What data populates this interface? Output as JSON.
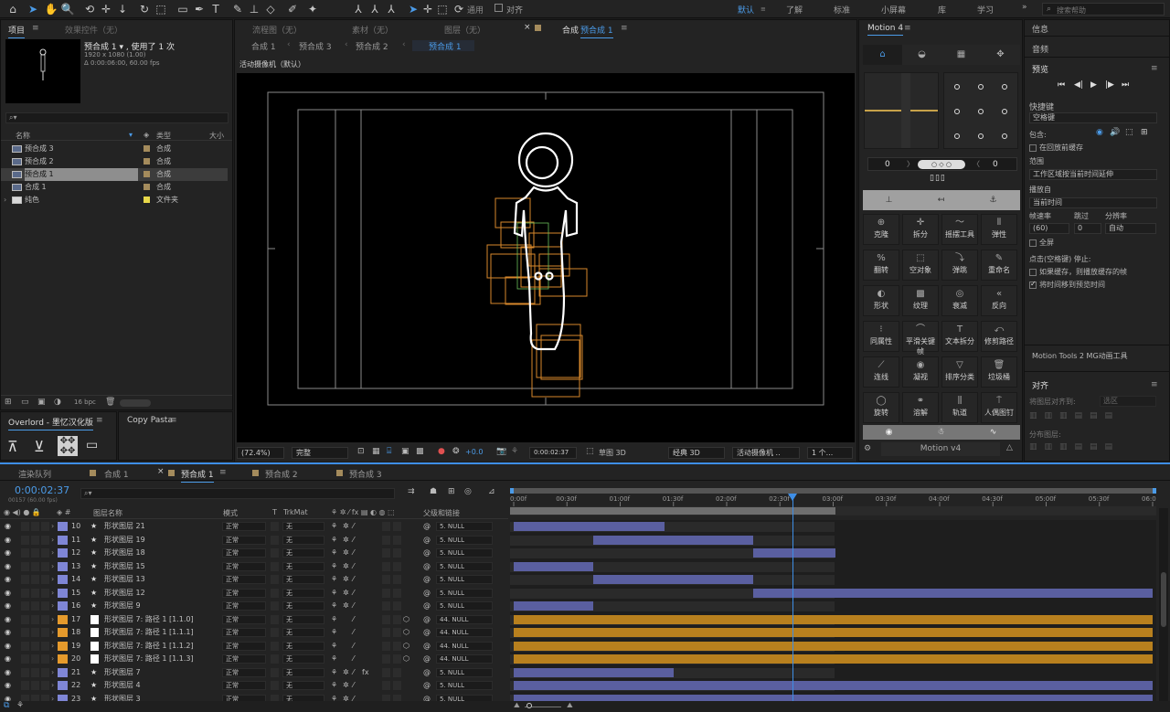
{
  "workspaces": [
    "默认",
    "了解",
    "标准",
    "小屏幕",
    "库",
    "学习"
  ],
  "active_workspace": "默认",
  "search_help_placeholder": "搜索帮助",
  "toolbar": {
    "snap_label": "通用",
    "align_label": "对齐"
  },
  "project": {
    "tab": "项目",
    "effects_tab": "效果控件（无）",
    "comp_name": "预合成 1 ▾ , 使用了 1 次",
    "comp_info1": "1920 x 1080 (1.00)",
    "comp_info2": "Δ 0:00:06:00, 60.00 fps",
    "col_name": "名称",
    "col_type": "类型",
    "col_size": "大小",
    "items": [
      {
        "name": "预合成 3",
        "type": "合成",
        "color": "#a48b5c"
      },
      {
        "name": "预合成 2",
        "type": "合成",
        "color": "#a48b5c"
      },
      {
        "name": "预合成 1",
        "type": "合成",
        "color": "#a48b5c"
      },
      {
        "name": "合成 1",
        "type": "合成",
        "color": "#a48b5c"
      },
      {
        "name": "纯色",
        "type": "文件夹",
        "color": "#e8d84a"
      }
    ],
    "bpc": "16 bpc"
  },
  "overlord": {
    "tab": "Overlord - 墨忆汉化版",
    "copy_tab": "Copy Pasta"
  },
  "viewer": {
    "tabs": [
      "流程图（无）",
      "素材（无）",
      "图层（无）"
    ],
    "comp_tab_prefix": "合成",
    "comp_tab": "预合成 1",
    "breadcrumbs": [
      "合成 1",
      "预合成 3",
      "预合成 2",
      "预合成 1"
    ],
    "camera_label": "活动摄像机（默认）",
    "zoom": "(72.4%)",
    "resolution": "完整",
    "timecode": "0:00:02:37",
    "exposure": "+0.0",
    "draft": "草图 3D",
    "renderer": "经典 3D",
    "camera": "活动摄像机 ..",
    "views": "1 个..."
  },
  "motion": {
    "title": "Motion 4",
    "num_left": "0",
    "num_right": "0",
    "buttons": [
      {
        "label": "克隆",
        "glyph": "⊕"
      },
      {
        "label": "拆分",
        "glyph": "✛"
      },
      {
        "label": "摇摆工具",
        "glyph": "〜"
      },
      {
        "label": "弹性",
        "glyph": "⫴"
      },
      {
        "label": "翻转",
        "glyph": "%"
      },
      {
        "label": "空对象",
        "glyph": "⬚"
      },
      {
        "label": "弹跳",
        "glyph": "⤵"
      },
      {
        "label": "重命名",
        "glyph": "✎"
      },
      {
        "label": "形状",
        "glyph": "◐"
      },
      {
        "label": "纹理",
        "glyph": "▩"
      },
      {
        "label": "衰减",
        "glyph": "◎"
      },
      {
        "label": "反向",
        "glyph": "«"
      },
      {
        "label": "同属性",
        "glyph": "⁝"
      },
      {
        "label": "平滑关键帧",
        "glyph": "⌒"
      },
      {
        "label": "文本拆分",
        "glyph": "T"
      },
      {
        "label": "修剪路径",
        "glyph": "⤺"
      },
      {
        "label": "连线",
        "glyph": "⟋"
      },
      {
        "label": "凝视",
        "glyph": "◉"
      },
      {
        "label": "排序分类",
        "glyph": "▽"
      },
      {
        "label": "垃圾桶",
        "glyph": "🗑"
      },
      {
        "label": "旋转",
        "glyph": "◯"
      },
      {
        "label": "溶解",
        "glyph": "⚭"
      },
      {
        "label": "轨道",
        "glyph": "⫼"
      },
      {
        "label": "人偶图钉",
        "glyph": "⍑"
      }
    ],
    "footer": "Motion v4"
  },
  "right": {
    "info": "信息",
    "audio": "音频",
    "preview": "预览",
    "shortcut_label": "快捷键",
    "shortcut_value": "空格键",
    "include_label": "包含:",
    "cache_label": "在回放前缓存",
    "range_label": "范围",
    "range_value": "工作区域按当前时间延伸",
    "play_from_label": "播放自",
    "play_from_value": "当前时间",
    "fps_label": "帧速率",
    "skip_label": "跳过",
    "res_label": "分辨率",
    "fps_value": "(60)",
    "skip_value": "0",
    "res_value": "自动",
    "fullscreen": "全屏",
    "stop_label": "点击(空格键) 停止:",
    "opt1": "如果缓存，则播放缓存的帧",
    "opt2": "将时间移到预览时间",
    "mg_label": "Motion Tools 2 MG动画工具",
    "align_title": "对齐",
    "align_to_label": "将图层对齐到:",
    "align_to_value": "选区",
    "distribute_label": "分布图层:"
  },
  "timeline": {
    "tabs": [
      "渲染队列",
      "合成 1",
      "预合成 1",
      "预合成 2",
      "预合成 3"
    ],
    "active_tab": "预合成 1",
    "timecode": "0:00:02:37",
    "frame": "00157 (60.00 fps)",
    "col_layer": "图层名称",
    "col_mode": "模式",
    "col_t": "T",
    "col_trk": "TrkMat",
    "col_parent": "父级和链接",
    "ruler": [
      "0:00f",
      "00:30f",
      "01:00f",
      "01:30f",
      "02:00f",
      "02:30f",
      "03:00f",
      "03:30f",
      "04:00f",
      "04:30f",
      "05:00f",
      "05:30f",
      "06:0"
    ],
    "layers": [
      {
        "num": "10",
        "name": "形状图层 21",
        "mode": "正常",
        "trk": "无",
        "parent": "5. NULL",
        "color": "#7f86d6",
        "kind": "shape",
        "start": 0.0,
        "end": 1.42
      },
      {
        "num": "11",
        "name": "形状图层 19",
        "mode": "正常",
        "trk": "无",
        "parent": "5. NULL",
        "color": "#7f86d6",
        "kind": "shape",
        "start": 0.75,
        "end": 2.25
      },
      {
        "num": "12",
        "name": "形状图层 18",
        "mode": "正常",
        "trk": "无",
        "parent": "5. NULL",
        "color": "#7f86d6",
        "kind": "shape",
        "start": 2.25,
        "end": 3.02
      },
      {
        "num": "13",
        "name": "形状图层 15",
        "mode": "正常",
        "trk": "无",
        "parent": "5. NULL",
        "color": "#7f86d6",
        "kind": "shape",
        "start": 0.0,
        "end": 0.75
      },
      {
        "num": "14",
        "name": "形状图层 13",
        "mode": "正常",
        "trk": "无",
        "parent": "5. NULL",
        "color": "#7f86d6",
        "kind": "shape",
        "start": 0.75,
        "end": 2.25
      },
      {
        "num": "15",
        "name": "形状图层 12",
        "mode": "正常",
        "trk": "无",
        "parent": "5. NULL",
        "color": "#7f86d6",
        "kind": "shape",
        "start": 2.25,
        "end": 6.0
      },
      {
        "num": "16",
        "name": "形状图层 9",
        "mode": "正常",
        "trk": "无",
        "parent": "5. NULL",
        "color": "#7f86d6",
        "kind": "shape",
        "start": 0.0,
        "end": 0.75
      },
      {
        "num": "17",
        "name": "形状图层 7: 路径 1 [1.1.0]",
        "mode": "正常",
        "trk": "无",
        "parent": "44. NULL",
        "color": "#e59a2c",
        "kind": "null",
        "start": 0.0,
        "end": 6.0
      },
      {
        "num": "18",
        "name": "形状图层 7: 路径 1 [1.1.1]",
        "mode": "正常",
        "trk": "无",
        "parent": "44. NULL",
        "color": "#e59a2c",
        "kind": "null",
        "start": 0.0,
        "end": 6.0
      },
      {
        "num": "19",
        "name": "形状图层 7: 路径 1 [1.1.2]",
        "mode": "正常",
        "trk": "无",
        "parent": "44. NULL",
        "color": "#e59a2c",
        "kind": "null",
        "start": 0.0,
        "end": 6.0
      },
      {
        "num": "20",
        "name": "形状图层 7: 路径 1 [1.1.3]",
        "mode": "正常",
        "trk": "无",
        "parent": "44. NULL",
        "color": "#e59a2c",
        "kind": "null",
        "start": 0.0,
        "end": 6.0
      },
      {
        "num": "21",
        "name": "形状图层 7",
        "mode": "正常",
        "trk": "无",
        "parent": "5. NULL",
        "color": "#7f86d6",
        "kind": "shape",
        "start": 0.0,
        "end": 1.5
      },
      {
        "num": "22",
        "name": "形状图层 4",
        "mode": "正常",
        "trk": "无",
        "parent": "5. NULL",
        "color": "#7f86d6",
        "kind": "shape",
        "start": 0.0,
        "end": 6.0
      },
      {
        "num": "23",
        "name": "形状图层 3",
        "mode": "正常",
        "trk": "无",
        "parent": "5. NULL",
        "color": "#7f86d6",
        "kind": "shape",
        "start": 0.0,
        "end": 6.0
      }
    ],
    "current_time_sec": 2.62,
    "work_end_sec": 3.02,
    "duration_sec": 6.0,
    "colors": {
      "shape_bar": "#5a5fa0",
      "null_bar": "#b8801e",
      "playhead": "#3e8ee6"
    }
  }
}
